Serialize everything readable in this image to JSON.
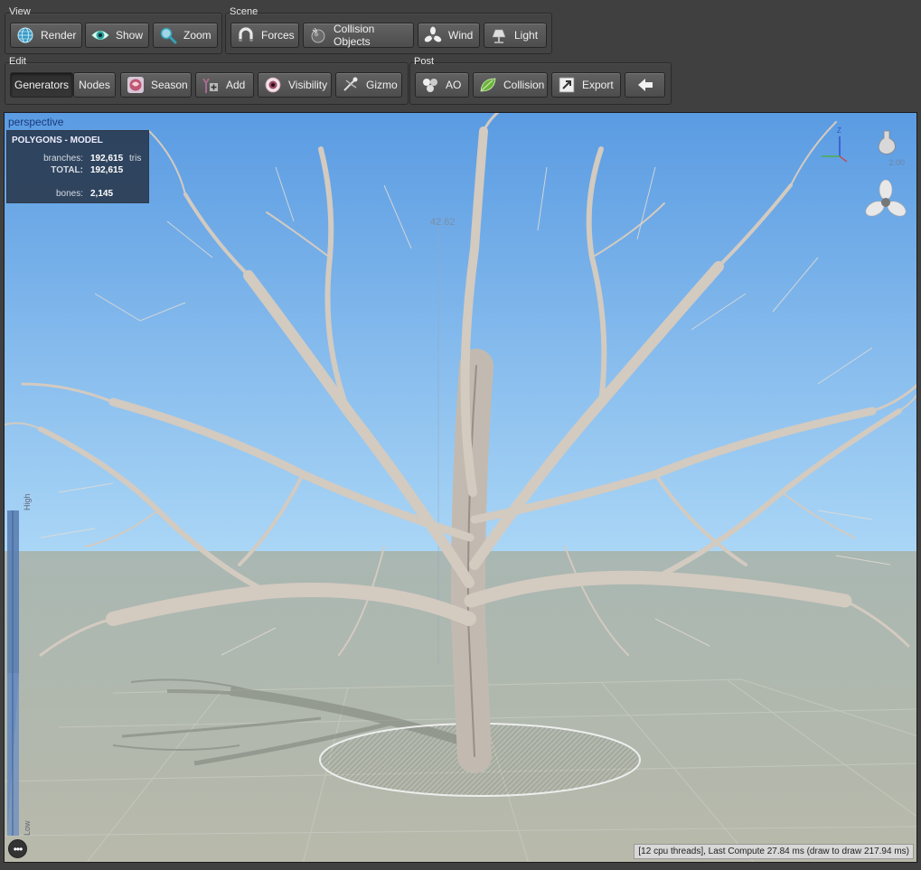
{
  "toolbar": {
    "view": {
      "label": "View",
      "buttons": [
        {
          "label": "Render",
          "icon": "globe-icon"
        },
        {
          "label": "Show",
          "icon": "eye-icon"
        },
        {
          "label": "Zoom",
          "icon": "magnifier-icon"
        }
      ]
    },
    "scene": {
      "label": "Scene",
      "buttons": [
        {
          "label": "Forces",
          "icon": "magnet-icon"
        },
        {
          "label": "Collision Objects",
          "icon": "sphere-icon"
        },
        {
          "label": "Wind",
          "icon": "fan-icon"
        },
        {
          "label": "Light",
          "icon": "lamp-icon"
        }
      ]
    },
    "edit": {
      "label": "Edit",
      "buttons": [
        {
          "label": "Generators",
          "icon": ""
        },
        {
          "label": "Nodes",
          "icon": ""
        },
        {
          "label": "Season",
          "icon": "season-icon"
        },
        {
          "label": "Add",
          "icon": "add-icon"
        },
        {
          "label": "Visibility",
          "icon": "eyeball-icon"
        },
        {
          "label": "Gizmo",
          "icon": "gizmo-icon"
        }
      ]
    },
    "post": {
      "label": "Post",
      "buttons": [
        {
          "label": "AO",
          "icon": "ao-icon"
        },
        {
          "label": "Collision",
          "icon": "leaf-icon"
        },
        {
          "label": "Export",
          "icon": "export-icon"
        },
        {
          "label": "",
          "icon": "back-arrow-icon"
        }
      ]
    }
  },
  "viewport": {
    "camera": "perspective",
    "height_readout": "42.62",
    "zoom_readout": "2.00",
    "axis_label": "Z",
    "lod_high": "High",
    "lod_low": "Low",
    "stats": {
      "title": "POLYGONS - MODEL",
      "branches_label": "branches:",
      "branches_value": "192,615",
      "branches_unit": "tris",
      "total_label": "TOTAL:",
      "total_value": "192,615",
      "bones_label": "bones:",
      "bones_value": "2,145"
    },
    "status": "[12 cpu threads], Last Compute 27.84 ms (draw to draw 217.94 ms)",
    "more": "•••"
  },
  "colors": {
    "sky_top": "#5a9be2",
    "sky_bottom": "#a9d4f4",
    "ground": "#b3b9ad",
    "bark": "#cfc7bd"
  }
}
